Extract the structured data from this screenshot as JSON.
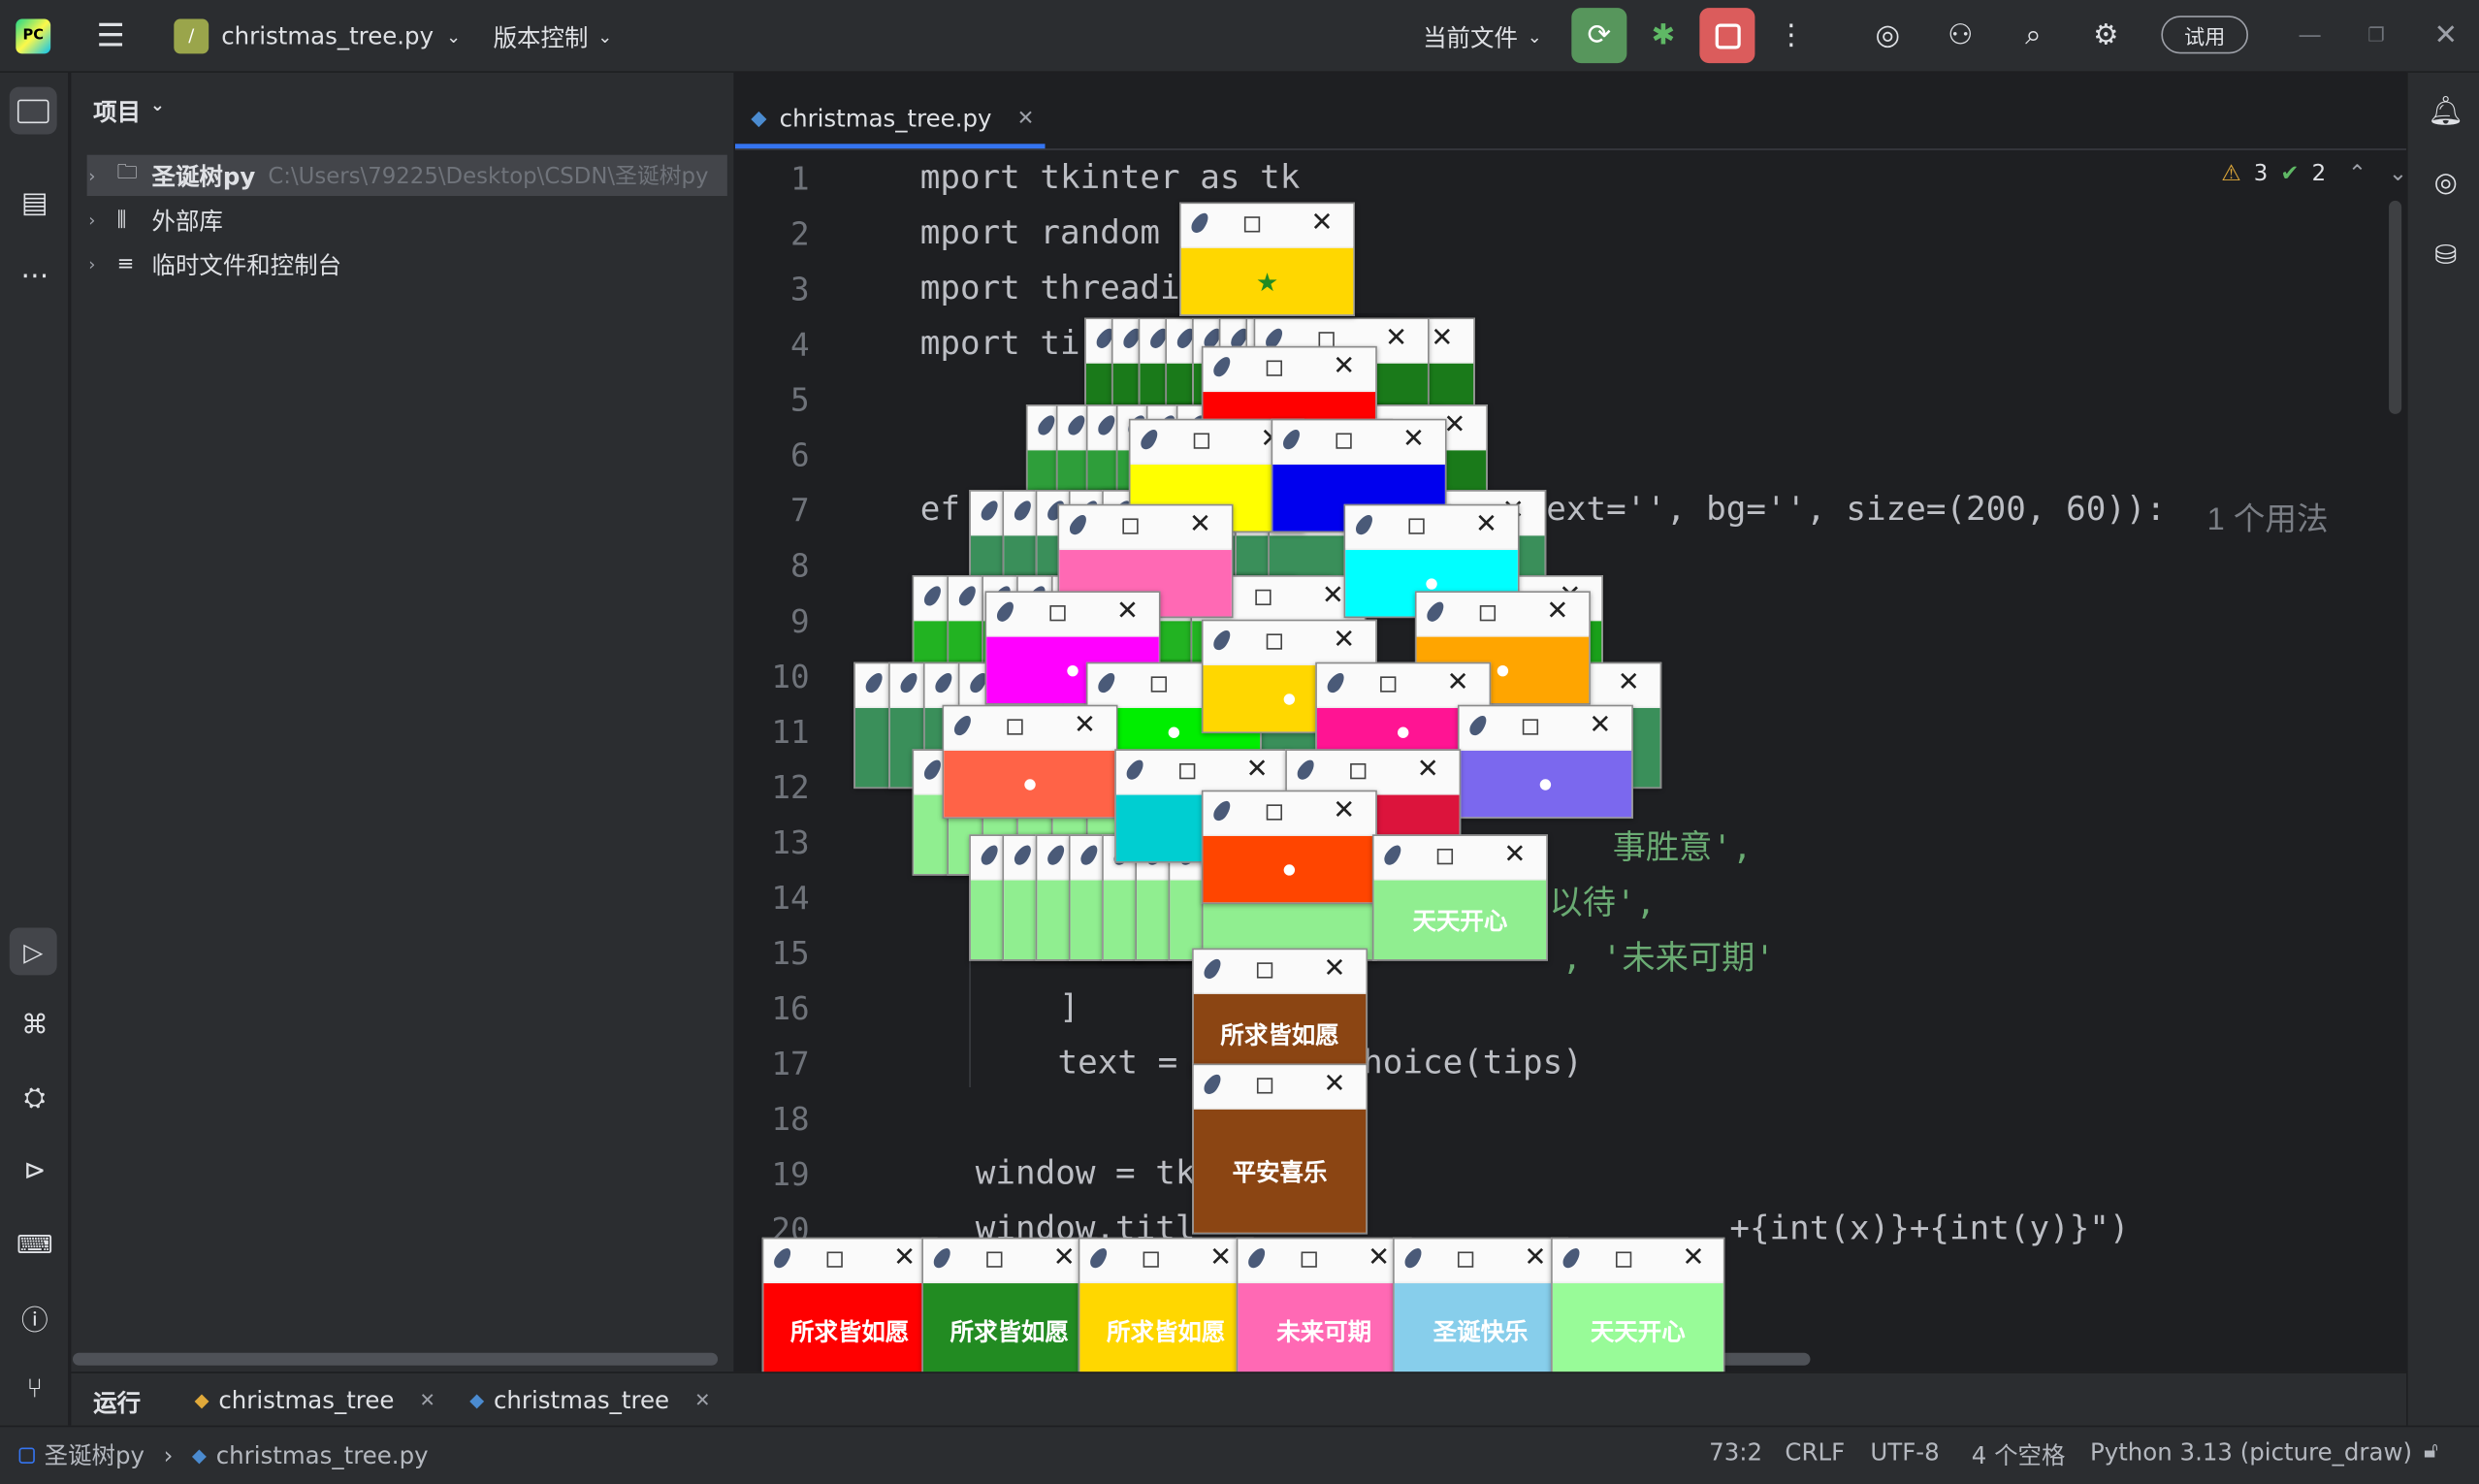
{
  "titlebar": {
    "file_label": "christmas_tree.py",
    "vcs_label": "版本控制",
    "run_config": "当前文件",
    "trial_label": "试用"
  },
  "project": {
    "header": "项目",
    "items": [
      {
        "name": "圣诞树py",
        "path": "C:\\Users\\79225\\Desktop\\CSDN\\圣诞树py"
      },
      {
        "name": "外部库"
      },
      {
        "name": "临时文件和控制台"
      }
    ]
  },
  "editor": {
    "tab": "christmas_tree.py",
    "warnings": "3",
    "checks": "2",
    "line_numbers": [
      "1",
      "2",
      "3",
      "4",
      "5",
      "6",
      "7",
      "8",
      "9",
      "10",
      "11",
      "12",
      "13",
      "14",
      "15",
      "16",
      "17",
      "18",
      "19",
      "20"
    ],
    "lines": [
      {
        "n": 0,
        "t": "mport tkinter as tk"
      },
      {
        "n": 1,
        "t": "mport random"
      },
      {
        "n": 2,
        "t": "mport threadi"
      },
      {
        "n": 3,
        "t": "mport ti"
      },
      {
        "n": 6,
        "t": "ef"
      },
      {
        "n": 6,
        "t": "ext='', bg='', size=(200, 60)):"
      },
      {
        "n": 12,
        "t": "事胜意',"
      },
      {
        "n": 13,
        "t": "以待',"
      },
      {
        "n": 14,
        "t": ", '未来可期'"
      },
      {
        "n": 15,
        "t": "]"
      },
      {
        "n": 16,
        "t": "text ="
      },
      {
        "n": 16,
        "t": "hoice(tips)"
      },
      {
        "n": 18,
        "t": "window = tk"
      },
      {
        "n": 19,
        "t": "window.titl"
      },
      {
        "n": 19,
        "t": "+{int(x)}+{int(y)}\")"
      }
    ],
    "usage_hint": "1 个用法"
  },
  "runbar": {
    "label": "运行",
    "tabs": [
      "christmas_tree",
      "christmas_tree"
    ]
  },
  "statusbar": {
    "project": "圣诞树py",
    "file": "christmas_tree.py",
    "position": "73:2",
    "line_sep": "CRLF",
    "encoding": "UTF-8",
    "indent": "4 个空格",
    "interpreter": "Python 3.13 (picture_draw)"
  },
  "popups": {
    "star": "★",
    "bottom": [
      {
        "text": "所求皆如愿",
        "color": "#ff0000"
      },
      {
        "text": "所求皆如愿",
        "color": "#228b22"
      },
      {
        "text": "所求皆如愿",
        "color": "#ffd700"
      },
      {
        "text": "未来可期",
        "color": "#ff69b4"
      },
      {
        "text": "圣诞快乐",
        "color": "#87ceeb"
      },
      {
        "text": "天天开心",
        "color": "#98fb98"
      }
    ],
    "trunk": [
      {
        "text": "所求皆如愿",
        "color": "#8b4513"
      },
      {
        "text": "平安喜乐",
        "color": "#8b4513"
      }
    ],
    "green_label": "天天开心"
  }
}
